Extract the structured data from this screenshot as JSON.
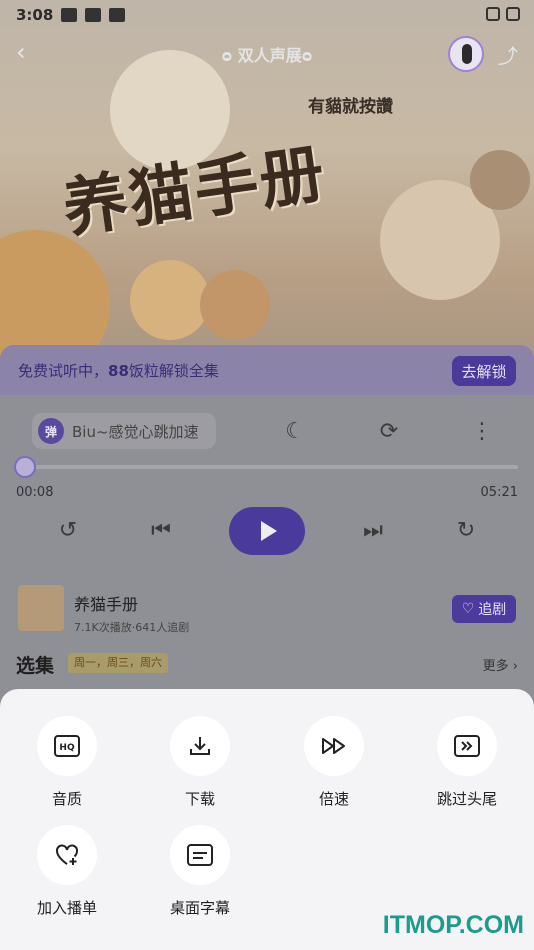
{
  "status_bar": {
    "time": "3:08"
  },
  "nav": {
    "title": "ᴑ 双人声展ᴑ"
  },
  "cover": {
    "title": "养猫手册",
    "tag": "有貓就按讚"
  },
  "trial": {
    "prefix": "免费试听中，",
    "count": "88",
    "suffix": "饭粒解锁全集",
    "unlock_label": "去解锁"
  },
  "danmaku": {
    "icon_label": "弹",
    "text": "Biu~感觉心跳加速"
  },
  "progress": {
    "current": "00:08",
    "total": "05:21",
    "fraction": 0.025
  },
  "album": {
    "title": "养猫手册",
    "stats": "7.1K次播放·641人追剧",
    "follow_label": "追剧"
  },
  "episodes": {
    "title": "选集",
    "days": "周一，周三，周六",
    "more_label": "更多"
  },
  "sheet": {
    "actions": [
      {
        "label": "音质",
        "icon": "hq-icon"
      },
      {
        "label": "下载",
        "icon": "download-icon"
      },
      {
        "label": "倍速",
        "icon": "speed-icon"
      },
      {
        "label": "跳过头尾",
        "icon": "skip-icon"
      },
      {
        "label": "加入播单",
        "icon": "heart-plus-icon"
      },
      {
        "label": "桌面字幕",
        "icon": "subtitle-icon"
      }
    ]
  },
  "watermark": "ITMOP.COM",
  "colors": {
    "accent": "#4b3a99",
    "sheet_bg": "#f4f4f7",
    "watermark": "#1b9c8d"
  }
}
